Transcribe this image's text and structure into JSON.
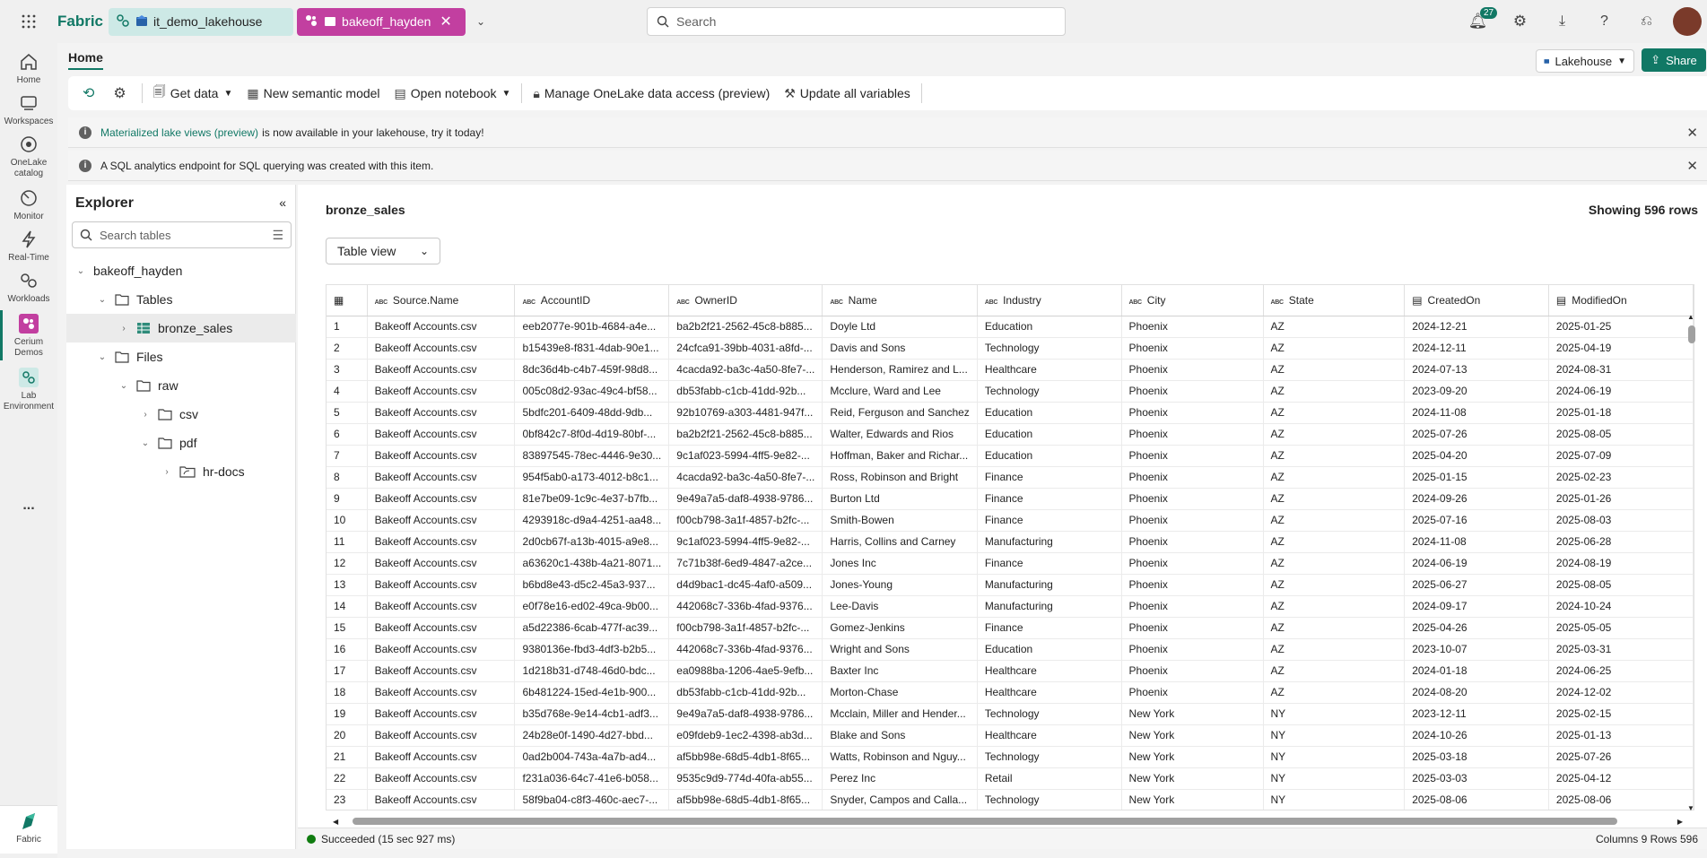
{
  "header": {
    "brand": "Fabric",
    "tabs": [
      {
        "label": "it_demo_lakehouse"
      },
      {
        "label": "bakeoff_hayden"
      }
    ],
    "search_placeholder": "Search",
    "notification_count": "27"
  },
  "leftnav": {
    "items": [
      {
        "label": "Home",
        "icon": "home-icon"
      },
      {
        "label": "Workspaces",
        "icon": "workspaces-icon"
      },
      {
        "label": "OneLake catalog",
        "icon": "onelake-icon"
      },
      {
        "label": "Monitor",
        "icon": "monitor-icon"
      },
      {
        "label": "Real-Time",
        "icon": "lightning-icon"
      },
      {
        "label": "Workloads",
        "icon": "workloads-icon"
      },
      {
        "label": "Cerium Demos",
        "icon": "cerium-icon"
      },
      {
        "label": "Lab Environment",
        "icon": "lab-icon"
      },
      {
        "label": "...",
        "icon": "more-icon"
      },
      {
        "label": "Fabric",
        "icon": "fabric-logo-icon"
      }
    ]
  },
  "ribbon": {
    "home_tab": "Home",
    "lakehouse_label": "Lakehouse",
    "share_label": "Share",
    "buttons": [
      "Get data",
      "New semantic model",
      "Open notebook",
      "Manage OneLake data access (preview)",
      "Update all variables"
    ]
  },
  "banners": {
    "b1_link": "Materialized lake views (preview)",
    "b1_text": "is now available in your lakehouse, try it today!",
    "b2_text": "A SQL analytics endpoint for SQL querying was created with this item."
  },
  "explorer": {
    "title": "Explorer",
    "search_placeholder": "Search tables",
    "tree": {
      "root": "bakeoff_hayden",
      "tables": "Tables",
      "table1": "bronze_sales",
      "files": "Files",
      "raw": "raw",
      "csv": "csv",
      "pdf": "pdf",
      "hrdocs": "hr-docs"
    }
  },
  "main": {
    "table_name": "bronze_sales",
    "row_count": "Showing 596 rows",
    "view_label": "Table view",
    "columns": [
      "Source.Name",
      "AccountID",
      "OwnerID",
      "Name",
      "Industry",
      "City",
      "State",
      "CreatedOn",
      "ModifiedOn"
    ],
    "rows": [
      [
        "1",
        "Bakeoff Accounts.csv",
        "eeb2077e-901b-4684-a4e...",
        "ba2b2f21-2562-45c8-b885...",
        "Doyle Ltd",
        "Education",
        "Phoenix",
        "AZ",
        "2024-12-21",
        "2025-01-25"
      ],
      [
        "2",
        "Bakeoff Accounts.csv",
        "b15439e8-f831-4dab-90e1...",
        "24cfca91-39bb-4031-a8fd-...",
        "Davis and Sons",
        "Technology",
        "Phoenix",
        "AZ",
        "2024-12-11",
        "2025-04-19"
      ],
      [
        "3",
        "Bakeoff Accounts.csv",
        "8dc36d4b-c4b7-459f-98d8...",
        "4cacda92-ba3c-4a50-8fe7-...",
        "Henderson, Ramirez and L...",
        "Healthcare",
        "Phoenix",
        "AZ",
        "2024-07-13",
        "2024-08-31"
      ],
      [
        "4",
        "Bakeoff Accounts.csv",
        "005c08d2-93ac-49c4-bf58...",
        "db53fabb-c1cb-41dd-92b...",
        "Mcclure, Ward and Lee",
        "Technology",
        "Phoenix",
        "AZ",
        "2023-09-20",
        "2024-06-19"
      ],
      [
        "5",
        "Bakeoff Accounts.csv",
        "5bdfc201-6409-48dd-9db...",
        "92b10769-a303-4481-947f...",
        "Reid, Ferguson and Sanchez",
        "Education",
        "Phoenix",
        "AZ",
        "2024-11-08",
        "2025-01-18"
      ],
      [
        "6",
        "Bakeoff Accounts.csv",
        "0bf842c7-8f0d-4d19-80bf-...",
        "ba2b2f21-2562-45c8-b885...",
        "Walter, Edwards and Rios",
        "Education",
        "Phoenix",
        "AZ",
        "2025-07-26",
        "2025-08-05"
      ],
      [
        "7",
        "Bakeoff Accounts.csv",
        "83897545-78ec-4446-9e30...",
        "9c1af023-5994-4ff5-9e82-...",
        "Hoffman, Baker and Richar...",
        "Education",
        "Phoenix",
        "AZ",
        "2025-04-20",
        "2025-07-09"
      ],
      [
        "8",
        "Bakeoff Accounts.csv",
        "954f5ab0-a173-4012-b8c1...",
        "4cacda92-ba3c-4a50-8fe7-...",
        "Ross, Robinson and Bright",
        "Finance",
        "Phoenix",
        "AZ",
        "2025-01-15",
        "2025-02-23"
      ],
      [
        "9",
        "Bakeoff Accounts.csv",
        "81e7be09-1c9c-4e37-b7fb...",
        "9e49a7a5-daf8-4938-9786...",
        "Burton Ltd",
        "Finance",
        "Phoenix",
        "AZ",
        "2024-09-26",
        "2025-01-26"
      ],
      [
        "10",
        "Bakeoff Accounts.csv",
        "4293918c-d9a4-4251-aa48...",
        "f00cb798-3a1f-4857-b2fc-...",
        "Smith-Bowen",
        "Finance",
        "Phoenix",
        "AZ",
        "2025-07-16",
        "2025-08-03"
      ],
      [
        "11",
        "Bakeoff Accounts.csv",
        "2d0cb67f-a13b-4015-a9e8...",
        "9c1af023-5994-4ff5-9e82-...",
        "Harris, Collins and Carney",
        "Manufacturing",
        "Phoenix",
        "AZ",
        "2024-11-08",
        "2025-06-28"
      ],
      [
        "12",
        "Bakeoff Accounts.csv",
        "a63620c1-438b-4a21-8071...",
        "7c71b38f-6ed9-4847-a2ce...",
        "Jones Inc",
        "Finance",
        "Phoenix",
        "AZ",
        "2024-06-19",
        "2024-08-19"
      ],
      [
        "13",
        "Bakeoff Accounts.csv",
        "b6bd8e43-d5c2-45a3-937...",
        "d4d9bac1-dc45-4af0-a509...",
        "Jones-Young",
        "Manufacturing",
        "Phoenix",
        "AZ",
        "2025-06-27",
        "2025-08-05"
      ],
      [
        "14",
        "Bakeoff Accounts.csv",
        "e0f78e16-ed02-49ca-9b00...",
        "442068c7-336b-4fad-9376...",
        "Lee-Davis",
        "Manufacturing",
        "Phoenix",
        "AZ",
        "2024-09-17",
        "2024-10-24"
      ],
      [
        "15",
        "Bakeoff Accounts.csv",
        "a5d22386-6cab-477f-ac39...",
        "f00cb798-3a1f-4857-b2fc-...",
        "Gomez-Jenkins",
        "Finance",
        "Phoenix",
        "AZ",
        "2025-04-26",
        "2025-05-05"
      ],
      [
        "16",
        "Bakeoff Accounts.csv",
        "9380136e-fbd3-4df3-b2b5...",
        "442068c7-336b-4fad-9376...",
        "Wright and Sons",
        "Education",
        "Phoenix",
        "AZ",
        "2023-10-07",
        "2025-03-31"
      ],
      [
        "17",
        "Bakeoff Accounts.csv",
        "1d218b31-d748-46d0-bdc...",
        "ea0988ba-1206-4ae5-9efb...",
        "Baxter Inc",
        "Healthcare",
        "Phoenix",
        "AZ",
        "2024-01-18",
        "2024-06-25"
      ],
      [
        "18",
        "Bakeoff Accounts.csv",
        "6b481224-15ed-4e1b-900...",
        "db53fabb-c1cb-41dd-92b...",
        "Morton-Chase",
        "Healthcare",
        "Phoenix",
        "AZ",
        "2024-08-20",
        "2024-12-02"
      ],
      [
        "19",
        "Bakeoff Accounts.csv",
        "b35d768e-9e14-4cb1-adf3...",
        "9e49a7a5-daf8-4938-9786...",
        "Mcclain, Miller and Hender...",
        "Technology",
        "New York",
        "NY",
        "2023-12-11",
        "2025-02-15"
      ],
      [
        "20",
        "Bakeoff Accounts.csv",
        "24b28e0f-1490-4d27-bbd...",
        "e09fdeb9-1ec2-4398-ab3d...",
        "Blake and Sons",
        "Healthcare",
        "New York",
        "NY",
        "2024-10-26",
        "2025-01-13"
      ],
      [
        "21",
        "Bakeoff Accounts.csv",
        "0ad2b004-743a-4a7b-ad4...",
        "af5bb98e-68d5-4db1-8f65...",
        "Watts, Robinson and Nguy...",
        "Technology",
        "New York",
        "NY",
        "2025-03-18",
        "2025-07-26"
      ],
      [
        "22",
        "Bakeoff Accounts.csv",
        "f231a036-64c7-41e6-b058...",
        "9535c9d9-774d-40fa-ab55...",
        "Perez Inc",
        "Retail",
        "New York",
        "NY",
        "2025-03-03",
        "2025-04-12"
      ],
      [
        "23",
        "Bakeoff Accounts.csv",
        "58f9ba04-c8f3-460c-aec7-...",
        "af5bb98e-68d5-4db1-8f65...",
        "Snyder, Campos and Calla...",
        "Technology",
        "New York",
        "NY",
        "2025-08-06",
        "2025-08-06"
      ]
    ]
  },
  "status": {
    "message": "Succeeded (15 sec 927 ms)",
    "summary": "Columns 9 Rows 596"
  }
}
